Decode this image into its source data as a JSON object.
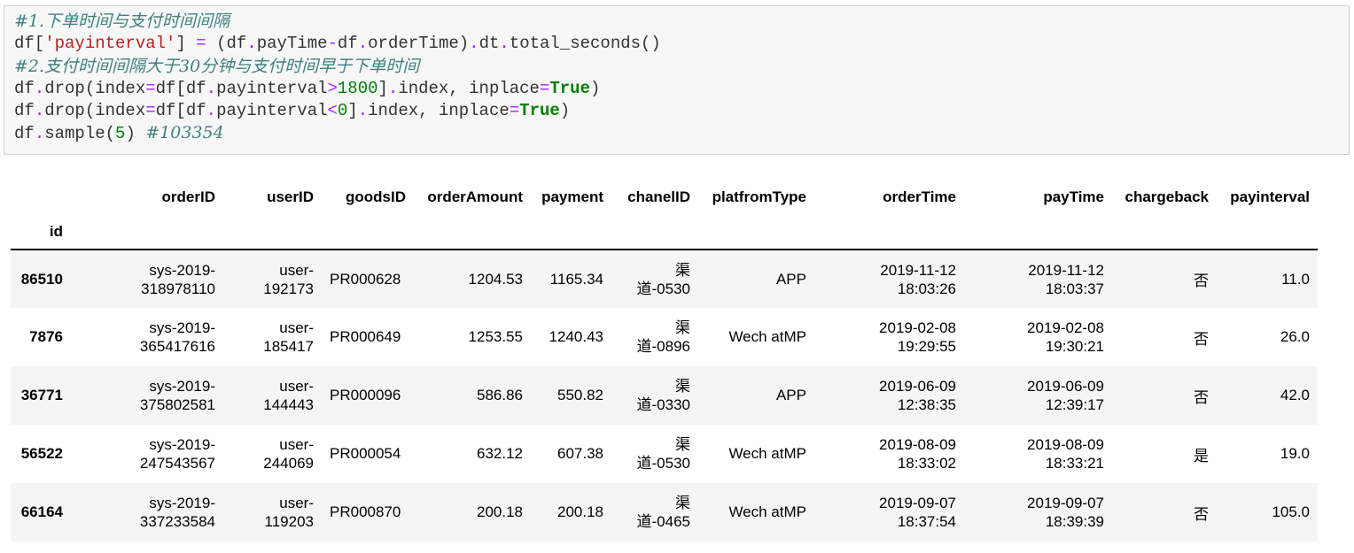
{
  "code_cell": {
    "lines": [
      [
        {
          "t": "cm",
          "v": "#1.下单时间与支付时间间隔"
        }
      ],
      [
        {
          "t": "",
          "v": "df["
        },
        {
          "t": "st",
          "v": "'payinterval'"
        },
        {
          "t": "",
          "v": "] "
        },
        {
          "t": "op",
          "v": "="
        },
        {
          "t": "",
          "v": " (df"
        },
        {
          "t": "op",
          "v": "."
        },
        {
          "t": "",
          "v": "payTime"
        },
        {
          "t": "op",
          "v": "-"
        },
        {
          "t": "",
          "v": "df"
        },
        {
          "t": "op",
          "v": "."
        },
        {
          "t": "",
          "v": "orderTime)"
        },
        {
          "t": "op",
          "v": "."
        },
        {
          "t": "",
          "v": "dt"
        },
        {
          "t": "op",
          "v": "."
        },
        {
          "t": "",
          "v": "total_seconds()"
        }
      ],
      [
        {
          "t": "cm",
          "v": "#2.支付时间间隔大于30分钟与支付时间早于下单时间"
        }
      ],
      [
        {
          "t": "",
          "v": "df"
        },
        {
          "t": "op",
          "v": "."
        },
        {
          "t": "",
          "v": "drop(index"
        },
        {
          "t": "op",
          "v": "="
        },
        {
          "t": "",
          "v": "df[df"
        },
        {
          "t": "op",
          "v": "."
        },
        {
          "t": "",
          "v": "payinterval"
        },
        {
          "t": "op",
          "v": ">"
        },
        {
          "t": "nu",
          "v": "1800"
        },
        {
          "t": "",
          "v": "]"
        },
        {
          "t": "op",
          "v": "."
        },
        {
          "t": "",
          "v": "index, inplace"
        },
        {
          "t": "op",
          "v": "="
        },
        {
          "t": "kw",
          "v": "True"
        },
        {
          "t": "",
          "v": ")"
        }
      ],
      [
        {
          "t": "",
          "v": "df"
        },
        {
          "t": "op",
          "v": "."
        },
        {
          "t": "",
          "v": "drop(index"
        },
        {
          "t": "op",
          "v": "="
        },
        {
          "t": "",
          "v": "df[df"
        },
        {
          "t": "op",
          "v": "."
        },
        {
          "t": "",
          "v": "payinterval"
        },
        {
          "t": "op",
          "v": "<"
        },
        {
          "t": "nu",
          "v": "0"
        },
        {
          "t": "",
          "v": "]"
        },
        {
          "t": "op",
          "v": "."
        },
        {
          "t": "",
          "v": "index, inplace"
        },
        {
          "t": "op",
          "v": "="
        },
        {
          "t": "kw",
          "v": "True"
        },
        {
          "t": "",
          "v": ")"
        }
      ],
      [
        {
          "t": "",
          "v": "df"
        },
        {
          "t": "op",
          "v": "."
        },
        {
          "t": "",
          "v": "sample("
        },
        {
          "t": "nu",
          "v": "5"
        },
        {
          "t": "",
          "v": ") "
        },
        {
          "t": "cm",
          "v": "#103354"
        }
      ]
    ]
  },
  "table": {
    "index_name": "id",
    "columns": [
      "orderID",
      "userID",
      "goodsID",
      "orderAmount",
      "payment",
      "chanelID",
      "platfromType",
      "orderTime",
      "payTime",
      "chargeback",
      "payinterval"
    ],
    "rows": [
      {
        "id": "86510",
        "orderID": [
          "sys-2019-",
          "318978110"
        ],
        "userID": [
          "user-",
          "192173"
        ],
        "goodsID": "PR000628",
        "orderAmount": "1204.53",
        "payment": "1165.34",
        "chanelID": [
          "渠",
          "道-0530"
        ],
        "platfromType": "APP",
        "orderTime": [
          "2019-11-12",
          "18:03:26"
        ],
        "payTime": [
          "2019-11-12",
          "18:03:37"
        ],
        "chargeback": "否",
        "payinterval": "11.0"
      },
      {
        "id": "7876",
        "orderID": [
          "sys-2019-",
          "365417616"
        ],
        "userID": [
          "user-",
          "185417"
        ],
        "goodsID": "PR000649",
        "orderAmount": "1253.55",
        "payment": "1240.43",
        "chanelID": [
          "渠",
          "道-0896"
        ],
        "platfromType": "Wech atMP",
        "orderTime": [
          "2019-02-08",
          "19:29:55"
        ],
        "payTime": [
          "2019-02-08",
          "19:30:21"
        ],
        "chargeback": "否",
        "payinterval": "26.0"
      },
      {
        "id": "36771",
        "orderID": [
          "sys-2019-",
          "375802581"
        ],
        "userID": [
          "user-",
          "144443"
        ],
        "goodsID": "PR000096",
        "orderAmount": "586.86",
        "payment": "550.82",
        "chanelID": [
          "渠",
          "道-0330"
        ],
        "platfromType": "APP",
        "orderTime": [
          "2019-06-09",
          "12:38:35"
        ],
        "payTime": [
          "2019-06-09",
          "12:39:17"
        ],
        "chargeback": "否",
        "payinterval": "42.0"
      },
      {
        "id": "56522",
        "orderID": [
          "sys-2019-",
          "247543567"
        ],
        "userID": [
          "user-",
          "244069"
        ],
        "goodsID": "PR000054",
        "orderAmount": "632.12",
        "payment": "607.38",
        "chanelID": [
          "渠",
          "道-0530"
        ],
        "platfromType": "Wech atMP",
        "orderTime": [
          "2019-08-09",
          "18:33:02"
        ],
        "payTime": [
          "2019-08-09",
          "18:33:21"
        ],
        "chargeback": "是",
        "payinterval": "19.0"
      },
      {
        "id": "66164",
        "orderID": [
          "sys-2019-",
          "337233584"
        ],
        "userID": [
          "user-",
          "119203"
        ],
        "goodsID": "PR000870",
        "orderAmount": "200.18",
        "payment": "200.18",
        "chanelID": [
          "渠",
          "道-0465"
        ],
        "platfromType": "Wech atMP",
        "orderTime": [
          "2019-09-07",
          "18:37:54"
        ],
        "payTime": [
          "2019-09-07",
          "18:39:39"
        ],
        "chargeback": "否",
        "payinterval": "105.0"
      }
    ]
  }
}
